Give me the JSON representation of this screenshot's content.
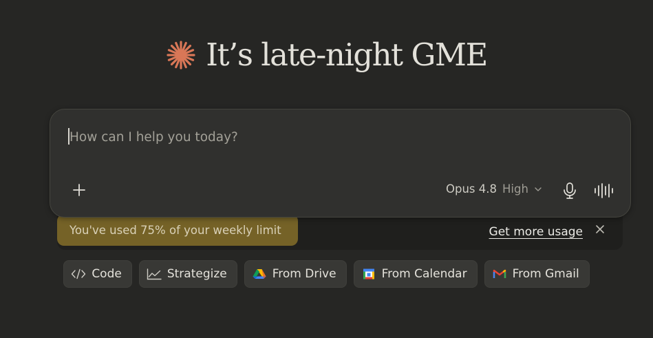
{
  "greeting": {
    "icon": "claude-spark-icon",
    "text": "It’s late-night GME",
    "accent_color": "#d97757"
  },
  "composer": {
    "placeholder": "How can I help you today?",
    "value": "",
    "model": "Opus 4.8",
    "effort": "High"
  },
  "limit_banner": {
    "message": "You've used 75% of your weekly limit",
    "action": "Get more usage",
    "highlight_color": "#756227"
  },
  "chips": [
    {
      "label": "Code",
      "icon": "code-icon"
    },
    {
      "label": "Strategize",
      "icon": "chart-line-icon"
    },
    {
      "label": "From Drive",
      "icon": "google-drive-icon"
    },
    {
      "label": "From Calendar",
      "icon": "google-calendar-icon"
    },
    {
      "label": "From Gmail",
      "icon": "gmail-icon"
    }
  ]
}
